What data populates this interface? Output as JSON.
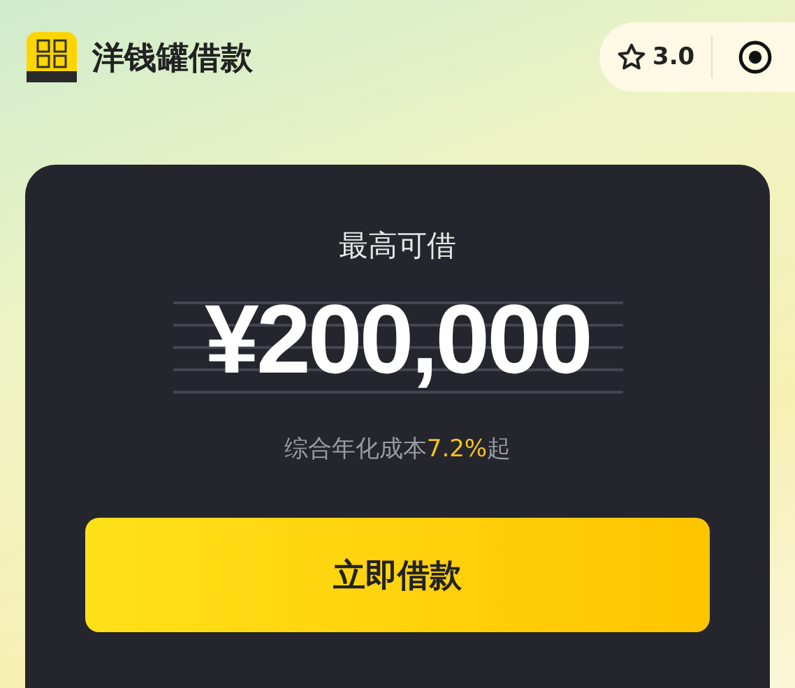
{
  "header": {
    "app_name": "洋钱罐借款",
    "rating": "3.0"
  },
  "card": {
    "label": "最高可借",
    "amount": "¥200,000",
    "rate_prefix": "综合年化成本",
    "rate_value": "7.2%",
    "rate_suffix": "起",
    "button": "立即借款"
  }
}
